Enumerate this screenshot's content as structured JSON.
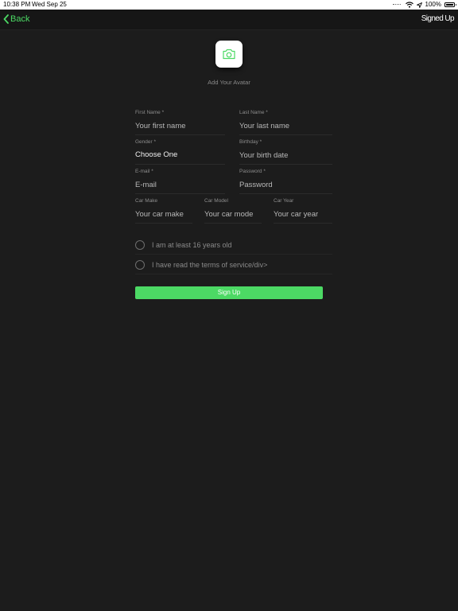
{
  "status_bar": {
    "time": "10:38 PM",
    "date": "Wed Sep 25",
    "battery": "100%",
    "icons": [
      "wifi-icon",
      "location-icon",
      "battery-icon"
    ]
  },
  "nav": {
    "back_label": "Back",
    "title": "Signed Up"
  },
  "avatar": {
    "label": "Add Your Avatar",
    "icon": "camera-icon"
  },
  "form": {
    "first_name": {
      "label": "First Name *",
      "placeholder": "Your first name"
    },
    "last_name": {
      "label": "Last Name *",
      "placeholder": "Your last name"
    },
    "gender": {
      "label": "Gender *",
      "value": "Choose One"
    },
    "birthday": {
      "label": "Birthday *",
      "placeholder": "Your birth date"
    },
    "email": {
      "label": "E-mail *",
      "placeholder": "E-mail"
    },
    "password": {
      "label": "Password *",
      "placeholder": "Password"
    },
    "car_make": {
      "label": "Car Make",
      "placeholder": "Your car make"
    },
    "car_model": {
      "label": "Car Model",
      "placeholder": "Your car mode"
    },
    "car_year": {
      "label": "Car Year",
      "placeholder": "Your car year"
    }
  },
  "checks": {
    "age": "I am at least 16 years old",
    "terms": "I have read the terms of service/div>"
  },
  "signup_label": "Sign Up",
  "colors": {
    "accent": "#4cd964",
    "background": "#1c1c1c",
    "nav_background": "#161616"
  }
}
